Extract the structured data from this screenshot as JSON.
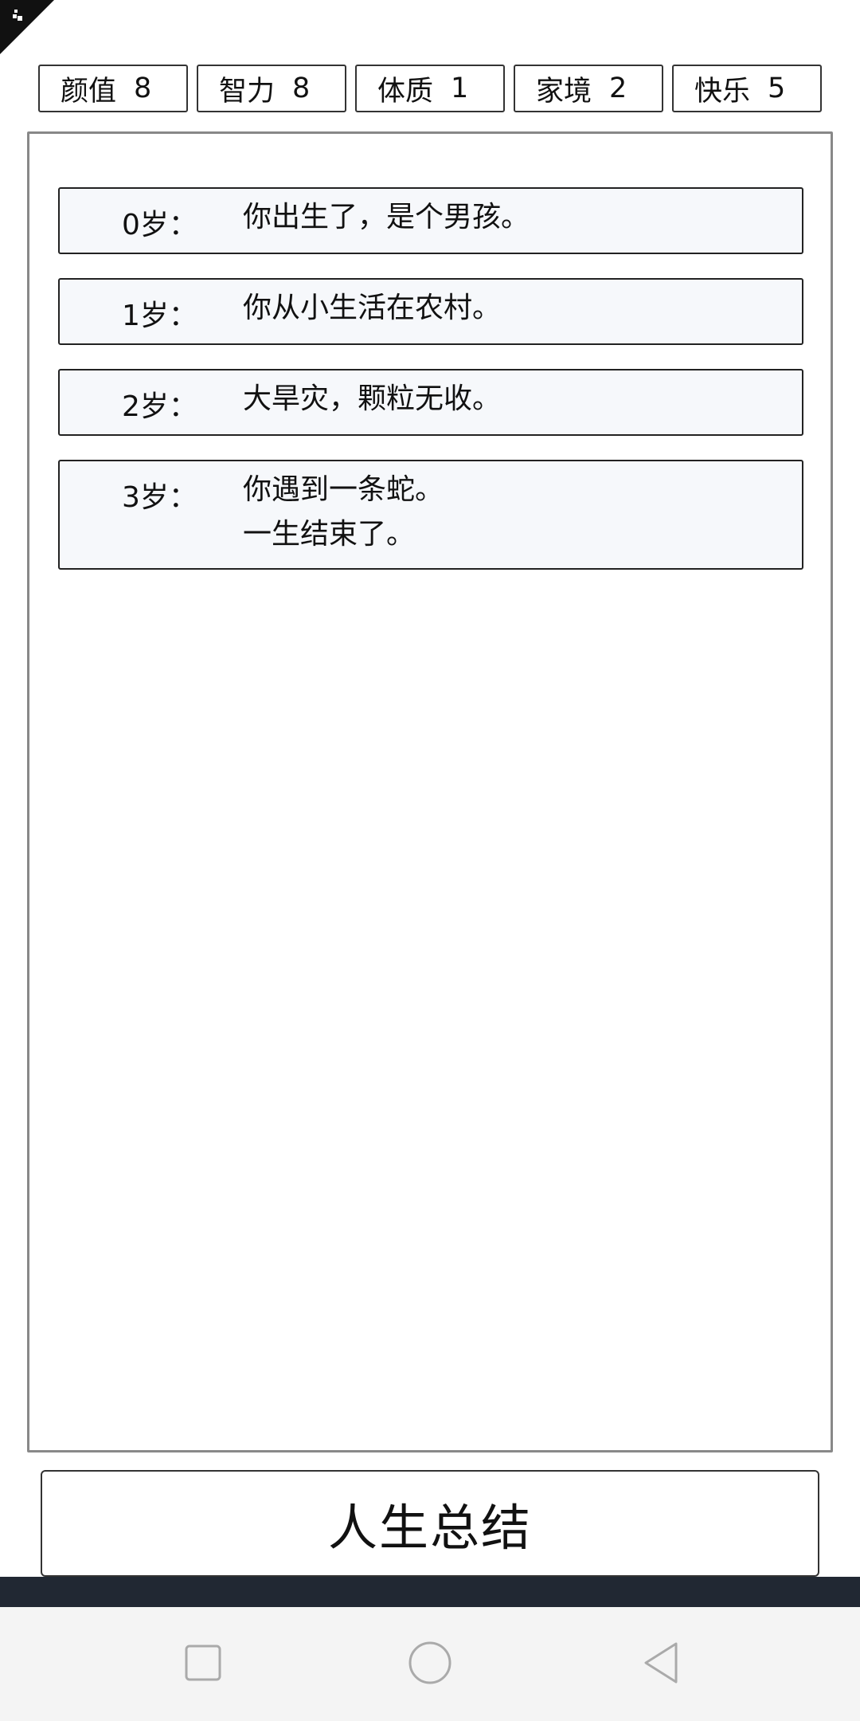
{
  "stats": [
    {
      "label": "颜值",
      "value": "8"
    },
    {
      "label": "智力",
      "value": "8"
    },
    {
      "label": "体质",
      "value": "1"
    },
    {
      "label": "家境",
      "value": "2"
    },
    {
      "label": "快乐",
      "value": "5"
    }
  ],
  "log": [
    {
      "age": "0岁：",
      "lines": [
        "你出生了，是个男孩。"
      ]
    },
    {
      "age": "1岁：",
      "lines": [
        "你从小生活在农村。"
      ]
    },
    {
      "age": "2岁：",
      "lines": [
        "大旱灾，颗粒无收。"
      ]
    },
    {
      "age": "3岁：",
      "lines": [
        "你遇到一条蛇。",
        "一生结束了。"
      ]
    }
  ],
  "summary_button": {
    "label": "人生总结"
  },
  "nav": {
    "recent_icon": "square-icon",
    "home_icon": "circle-icon",
    "back_icon": "triangle-back-icon"
  },
  "colors": {
    "entry_bg": "#f6f8fb",
    "dark_strip": "#212833",
    "nav_bg": "#f4f4f4"
  }
}
